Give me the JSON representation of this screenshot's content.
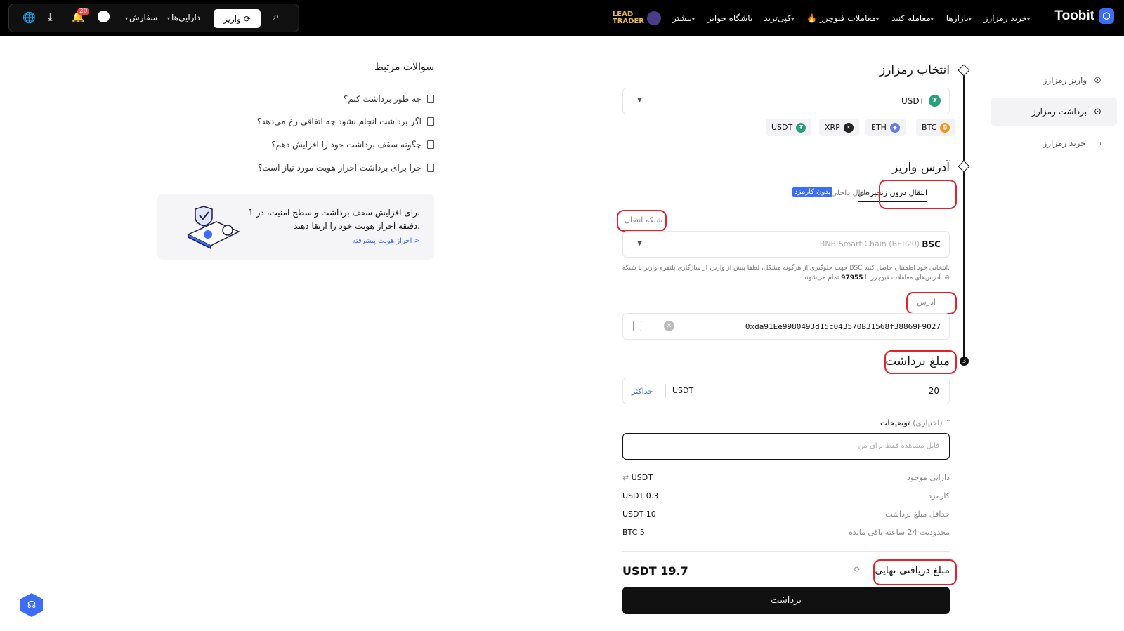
{
  "header": {
    "brand": "Toobit",
    "nav": [
      {
        "label": "خرید رمزارز",
        "caret": true
      },
      {
        "label": "بازارها",
        "caret": true
      },
      {
        "label": "معامله کنید",
        "caret": true
      },
      {
        "label": "معاملات فیوچرز",
        "caret": true
      },
      {
        "label": "کپی‌ترید",
        "caret": true
      },
      {
        "label": "باشگاه جوایز",
        "caret": false
      },
      {
        "label": "بیشتر",
        "caret": true
      }
    ],
    "lead_trader": "LEAD\nTRADER",
    "deposit_btn": "واریز",
    "assets": "دارایی‌ها",
    "orders": "سفارش",
    "notif_count": "20"
  },
  "sidebar": {
    "items": [
      {
        "label": "واریز رمزارز",
        "icon": "circle-arrow-down-icon"
      },
      {
        "label": "برداشت رمزارز",
        "icon": "circle-arrow-up-icon"
      },
      {
        "label": "خرید رمزارز",
        "icon": "card-icon"
      }
    ]
  },
  "select_crypto": {
    "title": "انتخاب رمزارز",
    "selected": "USDT",
    "chips": [
      "BTC",
      "ETH",
      "XRP",
      "USDT"
    ]
  },
  "address": {
    "title": "آدرس واریز",
    "tab_onchain": "انتقال درون زنجیره‌ای",
    "tab_internal": "انتقال داخلی",
    "free_badge": "بدون کارمزد",
    "network_label": "شبکه انتقال",
    "network_code": "BSC",
    "network_name": "BNB Smart Chain (BEP20)",
    "warning_line1": "جهت جلوگیری از هرگونه مشکل، لطفا پیش از واریز، از سازگاری پلتفرم واریز با شبکه BSC انتخابی خود اطمینان حاصل کنید.",
    "warning_line2_a": "آدرس‌های معاملات فیوچرز با",
    "warning_code": "97955",
    "warning_line2_b": "تمام می‌شوند.",
    "address_label": "آدرس",
    "address_value": "0xda91Ee9980493d15c043570B31568f38869F9027"
  },
  "amount": {
    "title": "مبلغ برداشت",
    "value": "20",
    "unit": "USDT",
    "max": "حداکثر",
    "notes_label": "توضیحات",
    "notes_optional": "(اختیاری)",
    "notes_placeholder": "قابل مشاهده فقط برای من",
    "rows": [
      {
        "label": "دارایی موجود",
        "value": "USDT"
      },
      {
        "label": "کارمزد",
        "value": "USDT 0.3"
      },
      {
        "label": "حداقل مبلغ برداشت",
        "value": "USDT 10"
      },
      {
        "label": "محدودیت 24 ساعته باقی مانده",
        "value": "BTC 5"
      }
    ],
    "final_label": "مبلغ دریافتی نهایی",
    "final_value": "USDT 19.7",
    "submit": "برداشت"
  },
  "faq": {
    "title": "سوالات مرتبط",
    "items": [
      "چه طور برداشت کنم؟",
      "اگر برداشت انجام نشود چه اتفاقی رخ می‌دهد؟",
      "چگونه سقف برداشت خود را افزایش دهم؟",
      "چرا برای برداشت احراز هویت مورد نیاز است؟"
    ]
  },
  "kyc": {
    "line1": "برای افزایش سقف برداشت و سطح امنیت، در 1",
    "line2": "دقیقه احراز هویت خود را ارتقا دهید.",
    "link": "احراز هویت پیشرفته >"
  },
  "colors": {
    "accent": "#3b6df6",
    "highlight": "#e52229",
    "tether": "#26a17b",
    "btc": "#f7931a"
  }
}
